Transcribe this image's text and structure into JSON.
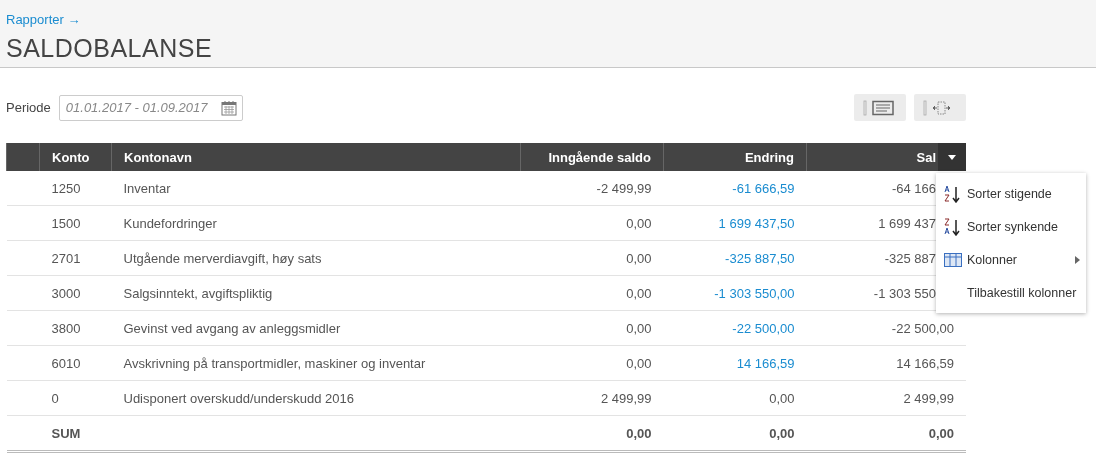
{
  "breadcrumb": {
    "label": "Rapporter",
    "arrow": "→"
  },
  "title": "SALDOBALANSE",
  "period": {
    "label": "Periode",
    "placeholder": "01.01.2017 - 01.09.2017"
  },
  "table": {
    "columns": [
      "Konto",
      "Kontonavn",
      "Inngående saldo",
      "Endring",
      "Sal"
    ],
    "rows": [
      {
        "konto": "1250",
        "name": "Inventar",
        "opening": "-2 499,99",
        "change": "-61 666,59",
        "change_linked": true,
        "balance": "-64 166"
      },
      {
        "konto": "1500",
        "name": "Kundefordringer",
        "opening": "0,00",
        "change": "1 699 437,50",
        "change_linked": true,
        "balance": "1 699 437"
      },
      {
        "konto": "2701",
        "name": "Utgående merverdiavgift, høy sats",
        "opening": "0,00",
        "change": "-325 887,50",
        "change_linked": true,
        "balance": "-325 887"
      },
      {
        "konto": "3000",
        "name": "Salgsinntekt, avgiftspliktig",
        "opening": "0,00",
        "change": "-1 303 550,00",
        "change_linked": true,
        "balance": "-1 303 550"
      },
      {
        "konto": "3800",
        "name": "Gevinst ved avgang av anleggsmidler",
        "opening": "0,00",
        "change": "-22 500,00",
        "change_linked": true,
        "balance": "-22 500,00"
      },
      {
        "konto": "6010",
        "name": "Avskrivning på transportmidler, maskiner og inventar",
        "opening": "0,00",
        "change": "14 166,59",
        "change_linked": true,
        "balance": "14 166,59"
      },
      {
        "konto": "0",
        "name": "Udisponert overskudd/underskudd 2016",
        "opening": "2 499,99",
        "change": "0,00",
        "change_linked": false,
        "balance": "2 499,99"
      }
    ],
    "sum": {
      "label": "SUM",
      "opening": "0,00",
      "change": "0,00",
      "balance": "0,00"
    }
  },
  "column_menu": {
    "items": [
      {
        "kind": "sort-asc",
        "label": "Sorter stigende"
      },
      {
        "kind": "sort-desc",
        "label": "Sorter synkende"
      },
      {
        "kind": "columns",
        "label": "Kolonner"
      },
      {
        "kind": "plain",
        "label": "Tilbakestill kolonner"
      }
    ]
  }
}
